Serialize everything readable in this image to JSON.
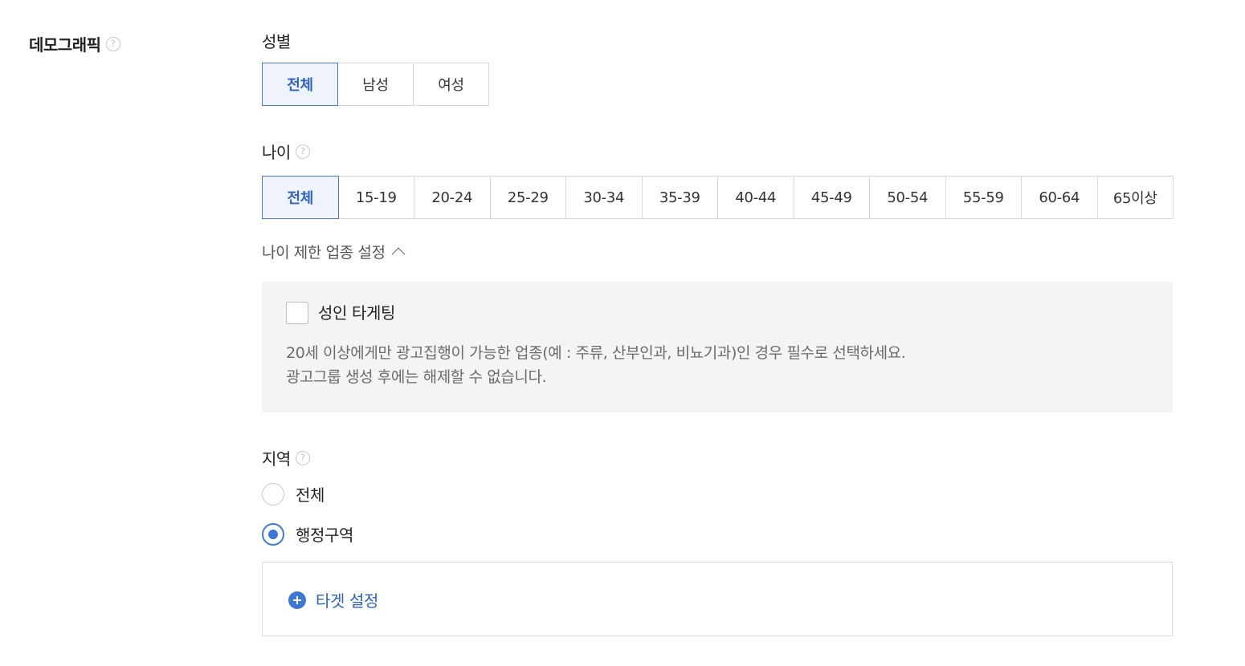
{
  "section": {
    "title": "데모그래픽",
    "help_glyph": "?"
  },
  "gender": {
    "label": "성별",
    "options": [
      "전체",
      "남성",
      "여성"
    ],
    "selected": "전체"
  },
  "age": {
    "label": "나이",
    "help_glyph": "?",
    "options": [
      "전체",
      "15-19",
      "20-24",
      "25-29",
      "30-34",
      "35-39",
      "40-44",
      "45-49",
      "50-54",
      "55-59",
      "60-64",
      "65이상"
    ],
    "selected": "전체",
    "restriction_toggle": "나이 제한 업종 설정",
    "adult_targeting": {
      "checkbox_label": "성인 타게팅",
      "checked": false,
      "desc_line1": "20세 이상에게만 광고집행이 가능한 업종(예 : 주류, 산부인과, 비뇨기과)인 경우 필수로 선택하세요.",
      "desc_line2": "광고그룹 생성 후에는 해제할 수 없습니다."
    }
  },
  "region": {
    "label": "지역",
    "help_glyph": "?",
    "options": [
      "전체",
      "행정구역"
    ],
    "selected": "행정구역",
    "target_button": "타겟 설정"
  },
  "colors": {
    "accent": "#3d78d8",
    "selected_bg": "#eef3fc",
    "panel_bg": "#f4f4f4"
  }
}
